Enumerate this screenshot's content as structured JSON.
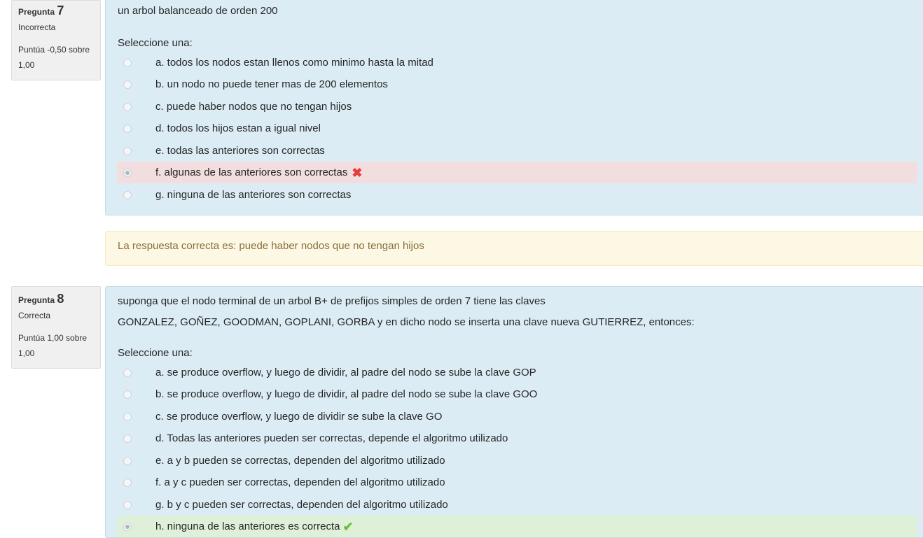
{
  "q7": {
    "label": "Pregunta",
    "number": "7",
    "state": "Incorrecta",
    "grade_line1": "Puntúa -0,50 sobre",
    "grade_line2": "1,00",
    "text": "un arbol balanceado de orden 200",
    "prompt": "Seleccione una:",
    "options": [
      {
        "label": "a. todos los nodos estan llenos como minimo hasta la mitad",
        "status": "none"
      },
      {
        "label": "b. un nodo no puede tener mas de 200 elementos",
        "status": "none"
      },
      {
        "label": "c. puede haber nodos que no tengan hijos",
        "status": "none"
      },
      {
        "label": "d. todos los hijos estan a igual nivel",
        "status": "none"
      },
      {
        "label": "e. todas las anteriores son correctas",
        "status": "none"
      },
      {
        "label": "f. algunas de las anteriores son correctas",
        "status": "incorrect",
        "selected": true
      },
      {
        "label": "g. ninguna de las anteriores son correctas",
        "status": "none"
      }
    ],
    "feedback": "La respuesta correcta es: puede haber nodos que no tengan hijos"
  },
  "q8": {
    "label": "Pregunta",
    "number": "8",
    "state": "Correcta",
    "grade_line1": "Puntúa 1,00 sobre",
    "grade_line2": "1,00",
    "text_line1": "suponga que el nodo terminal de un arbol B+ de prefijos simples de orden 7 tiene las claves",
    "text_line2": "GONZALEZ, GOÑEZ, GOODMAN, GOPLANI, GORBA y en dicho nodo se inserta una clave nueva GUTIERREZ, entonces:",
    "prompt": "Seleccione una:",
    "options": [
      {
        "label": "a. se produce overflow, y luego de dividir, al padre del nodo se sube la clave GOP",
        "status": "none"
      },
      {
        "label": "b. se produce  overflow, y luego de dividir, al padre del nodo se sube la clave GOO",
        "status": "none"
      },
      {
        "label": "c. se produce overflow, y luego de dividir se sube la clave GO",
        "status": "none"
      },
      {
        "label": "d. Todas las anteriores pueden ser correctas, depende el algoritmo utilizado",
        "status": "none"
      },
      {
        "label": "e. a y b pueden se correctas, dependen del algoritmo utilizado",
        "status": "none"
      },
      {
        "label": "f. a y c pueden ser correctas, dependen del algoritmo utilizado",
        "status": "none"
      },
      {
        "label": "g. b y c pueden ser correctas, dependen del algoritmo utilizado",
        "status": "none"
      },
      {
        "label": "h. ninguna de las anteriores es correcta",
        "status": "correct",
        "selected": true
      }
    ]
  },
  "icons": {
    "incorrect": "cross-icon",
    "correct": "check-icon"
  },
  "colors": {
    "incorrect_bg": "#f2dede",
    "correct_bg": "#dff0d8",
    "formulation_bg": "#dcecf5",
    "feedback_bg": "#fcf8e3",
    "cross": "#e53c3c",
    "check": "#6cbf3b"
  }
}
